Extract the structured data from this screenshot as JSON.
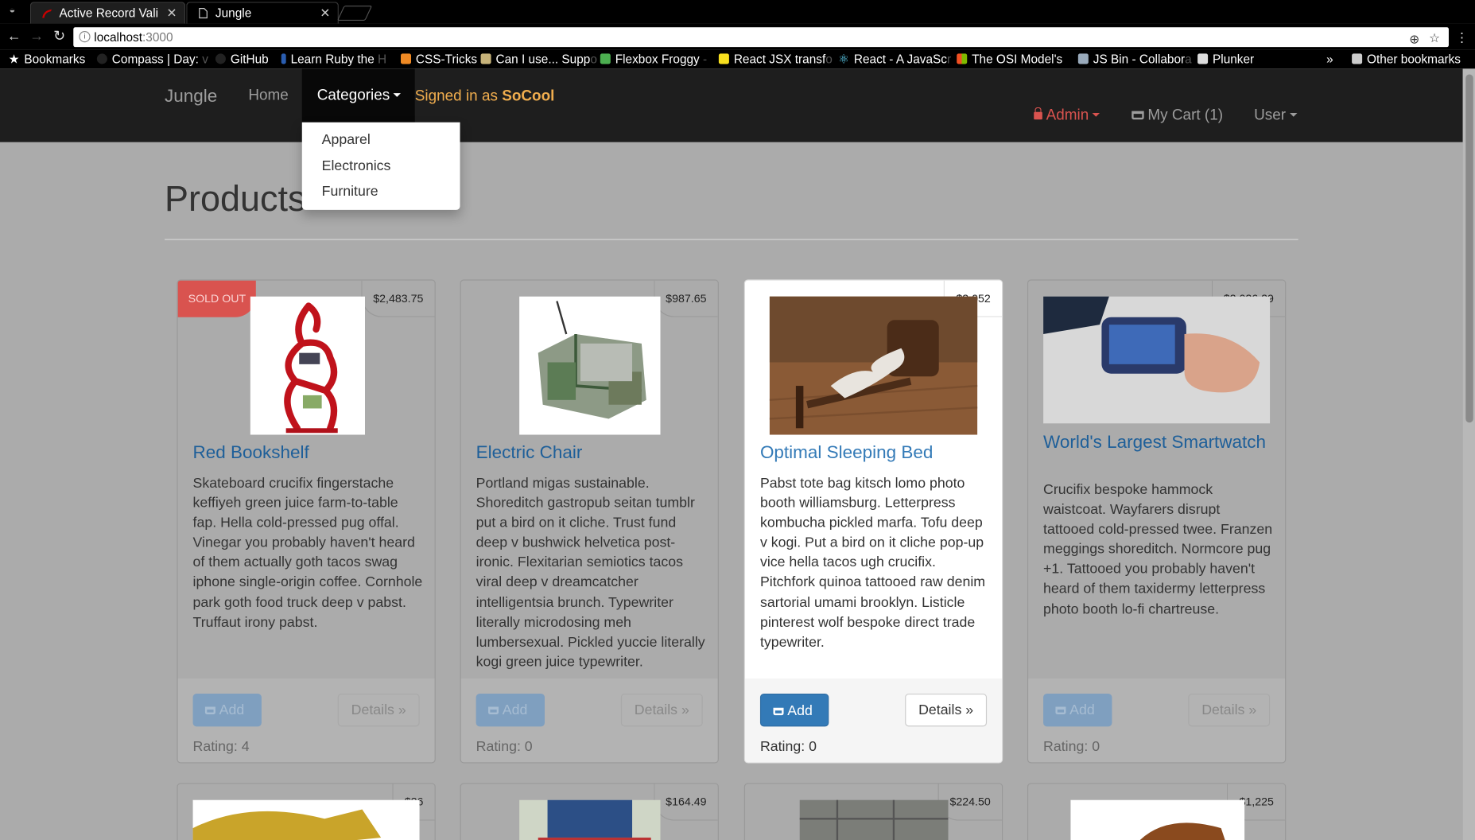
{
  "browser": {
    "tabs": [
      {
        "title": "Active Record Vali",
        "active": true
      },
      {
        "title": "Jungle",
        "active": false
      }
    ],
    "url_host": "localhost",
    "url_port": ":3000",
    "bookmarks": [
      {
        "label": "Bookmarks",
        "icon": "star-icon"
      },
      {
        "label": "Compass | Day: ",
        "fade": "v",
        "icon": "compass-icon"
      },
      {
        "label": "GitHub",
        "icon": "github-icon"
      },
      {
        "label": "Learn Ruby the ",
        "fade": "H",
        "icon": "ruby-icon"
      },
      {
        "label": "CSS-Tricks",
        "icon": "csstricks-icon"
      },
      {
        "label": "Can I use... Supp",
        "fade": "o",
        "icon": "caniuse-icon"
      },
      {
        "label": "Flexbox Froggy ",
        "fade": "-",
        "icon": "frog-icon"
      },
      {
        "label": "React JSX transf",
        "fade": "o",
        "icon": "jsx-icon"
      },
      {
        "label": "React - A JavaSc",
        "fade": "r",
        "icon": "react-icon"
      },
      {
        "label": "The OSI Model's",
        "fade": " ",
        "icon": "windows-icon"
      },
      {
        "label": "JS Bin - Collabor",
        "fade": "a",
        "icon": "jsbin-icon"
      },
      {
        "label": "Plunker",
        "icon": "plunker-icon"
      },
      {
        "label": "»",
        "icon": ""
      },
      {
        "label": "Other bookmarks",
        "icon": "folder-icon"
      }
    ]
  },
  "nav": {
    "brand": "Jungle",
    "home": "Home",
    "categories": "Categories",
    "signed_prefix": "Signed in as ",
    "signed_user": "SoCool",
    "admin": "Admin",
    "cart": "My Cart (1)",
    "user": "User",
    "dropdown": [
      "Apparel",
      "Electronics",
      "Furniture"
    ]
  },
  "main": {
    "title": "Products",
    "add_label": "Add",
    "details_label": "Details »",
    "sold_out": "SOLD OUT",
    "products": [
      {
        "name": "Red Bookshelf",
        "price": "$2,483.75",
        "sold_out": true,
        "rating": "Rating: 4",
        "desc": "Skateboard crucifix fingerstache keffiyeh green juice farm-to-table fap. Hella cold-pressed pug offal. Vinegar you probably haven't heard of them actually goth tacos swag iphone single-origin coffee. Cornhole park goth food truck deep v pabst. Truffaut irony pabst."
      },
      {
        "name": "Electric Chair",
        "price": "$987.65",
        "sold_out": false,
        "rating": "Rating: 0",
        "desc": "Portland migas sustainable. Shoreditch gastropub seitan tumblr put a bird on it cliche. Trust fund deep v bushwick helvetica post-ironic. Flexitarian semiotics tacos viral deep v dreamcatcher intelligentsia brunch. Typewriter literally microdosing meh lumbersexual. Pickled yuccie literally kogi green juice typewriter."
      },
      {
        "name": "Optimal Sleeping Bed",
        "price": "$3,052",
        "sold_out": false,
        "rating": "Rating: 0",
        "desc": "Pabst tote bag kitsch lomo photo booth williamsburg. Letterpress kombucha pickled marfa. Tofu deep v kogi. Put a bird on it cliche pop-up vice hella tacos ugh crucifix. Pitchfork quinoa tattooed raw denim sartorial umami brooklyn. Listicle pinterest wolf bespoke direct trade typewriter."
      },
      {
        "name": "World's Largest Smartwatch",
        "price": "$2,026.29",
        "sold_out": false,
        "rating": "Rating: 0",
        "desc": "Crucifix bespoke hammock waistcoat. Wayfarers disrupt tattooed cold-pressed twee. Franzen meggings shoreditch. Normcore pug +1. Tattooed you probably haven't heard of them taxidermy letterpress photo booth lo-fi chartreuse."
      }
    ],
    "next_prices": [
      "$26",
      "$164.49",
      "$224.50",
      "$1,225"
    ]
  }
}
